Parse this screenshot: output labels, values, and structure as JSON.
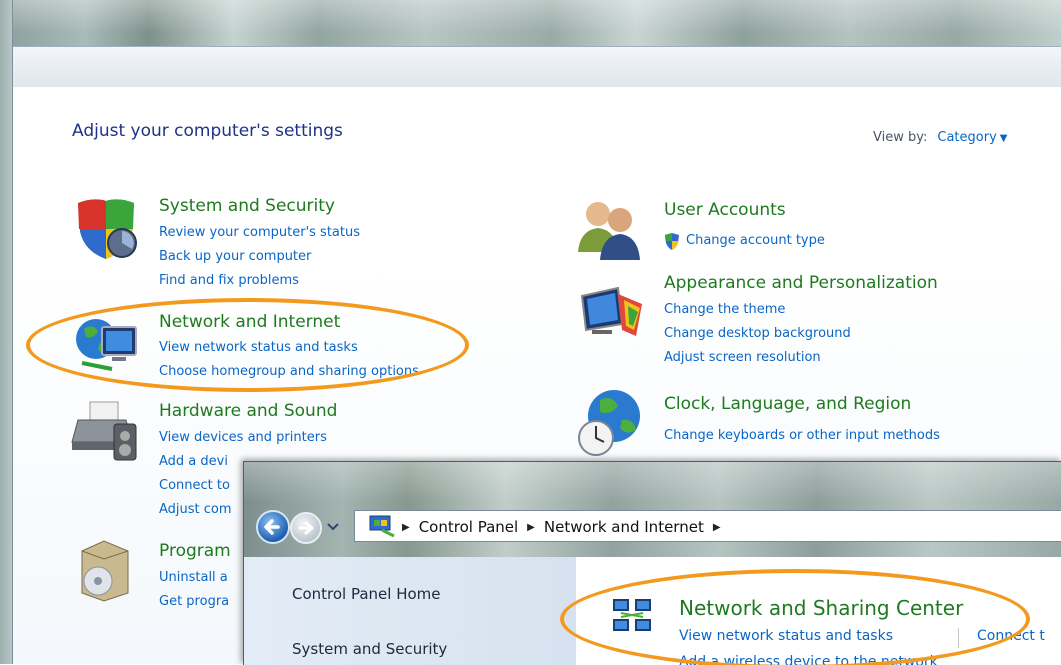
{
  "main": {
    "heading": "Adjust your computer's settings",
    "view_by_label": "View by:",
    "view_by_value": "Category",
    "categories": [
      {
        "title": "System and Security",
        "icon": "shield-icon",
        "links": [
          "Review your computer's status",
          "Back up your computer",
          "Find and fix problems"
        ]
      },
      {
        "title": "Network and Internet",
        "icon": "network-globe-icon",
        "links": [
          "View network status and tasks",
          "Choose homegroup and sharing options"
        ]
      },
      {
        "title": "Hardware and Sound",
        "icon": "printer-icon",
        "links": [
          "View devices and printers",
          "Add a devi",
          "Connect to",
          "Adjust com"
        ]
      },
      {
        "title": "Program",
        "icon": "programs-icon",
        "links": [
          "Uninstall a",
          "Get progra"
        ]
      },
      {
        "title": "User Accounts",
        "icon": "users-icon",
        "links": [
          "Change account type"
        ]
      },
      {
        "title": "Appearance and Personalization",
        "icon": "monitor-paint-icon",
        "links": [
          "Change the theme",
          "Change desktop background",
          "Adjust screen resolution"
        ]
      },
      {
        "title": "Clock, Language, and Region",
        "icon": "globe-clock-icon",
        "links": [
          "Change keyboards or other input methods"
        ]
      }
    ]
  },
  "second_window": {
    "breadcrumb": [
      "Control Panel",
      "Network and Internet"
    ],
    "left_pane": [
      "Control Panel Home",
      "System and Security"
    ],
    "section_title": "Network and Sharing Center",
    "links": [
      "View network status and tasks",
      "Connect t",
      "Add a wireless device to the network"
    ]
  },
  "colors": {
    "category_title": "#1f7a1f",
    "link": "#0a66c6",
    "heading": "#1e3287",
    "highlight": "#f39a1e"
  }
}
